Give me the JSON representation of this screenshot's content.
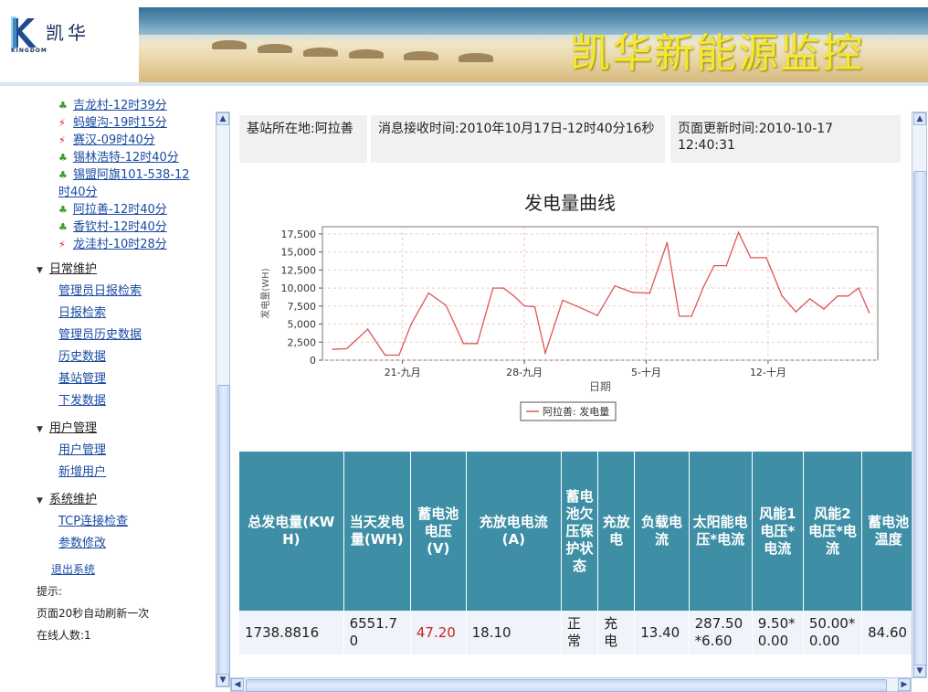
{
  "header": {
    "logo_text": "凯华",
    "logo_sub": "KINGDOM",
    "title": "凯华新能源监控"
  },
  "sidebar": {
    "stations": [
      {
        "label": "吉龙村-12时39分",
        "status": "ok"
      },
      {
        "label": "蚂蝗沟-19时15分",
        "status": "bad"
      },
      {
        "label": "赛汉-09时40分",
        "status": "bad"
      },
      {
        "label": "锡林浩特-12时40分",
        "status": "ok"
      },
      {
        "label": "锡盟阿旗101-538-12",
        "label2": "时40分",
        "status": "ok"
      },
      {
        "label": "阿拉善-12时40分",
        "status": "ok"
      },
      {
        "label": "香钦村-12时40分",
        "status": "ok"
      },
      {
        "label": "龙洼村-10时28分",
        "status": "bad"
      }
    ],
    "groups": [
      {
        "label": "日常维护",
        "items": [
          "管理员日报检索",
          "日报检索",
          "管理员历史数据",
          "历史数据",
          "基站管理",
          "下发数据"
        ]
      },
      {
        "label": "用户管理",
        "items": [
          "用户管理",
          "新增用户"
        ]
      },
      {
        "label": "系统维护",
        "items": [
          "TCP连接检查",
          "参数修改"
        ]
      }
    ],
    "logout": "退出系统",
    "tip_label": "提示:",
    "refresh_note": "页面20秒自动刷新一次",
    "online": "在线人数:1"
  },
  "info": {
    "location": "基站所在地:阿拉善",
    "received": "消息接收时间:2010年10月17日-12时40分16秒",
    "updated": "页面更新时间:2010-10-17 12:40:31"
  },
  "chart_data": {
    "type": "line",
    "title": "发电量曲线",
    "xlabel": "日期",
    "ylabel": "发电量(WH)",
    "ylim": [
      0,
      18500
    ],
    "yticks": [
      "0",
      "2,500",
      "5,000",
      "7,500",
      "10,000",
      "12,500",
      "15,000",
      "17,500"
    ],
    "xticks": [
      {
        "label": "21-九月",
        "day": 21
      },
      {
        "label": "28-九月",
        "day": 28
      },
      {
        "label": "5-十月",
        "day": 35
      },
      {
        "label": "12-十月",
        "day": 42
      }
    ],
    "series": [
      {
        "name": "阿拉善: 发电量",
        "color": "#e05555",
        "x": [
          17,
          17.8,
          19,
          20,
          20.8,
          21.5,
          22.5,
          23.5,
          24.5,
          25.3,
          26.2,
          26.8,
          27.4,
          28,
          28.6,
          29.2,
          30.2,
          31,
          32.2,
          33.2,
          34.2,
          35.2,
          36.2,
          36.9,
          37.6,
          38.3,
          38.9,
          39.6,
          40.3,
          41,
          41.9,
          42.8,
          43.6,
          44.4,
          45.2,
          46,
          46.6,
          47.2,
          47.8
        ],
        "values": [
          1500,
          1600,
          4300,
          700,
          700,
          5000,
          9300,
          7600,
          2300,
          2300,
          10000,
          10000,
          8900,
          7500,
          7400,
          1000,
          8300,
          7500,
          6200,
          10300,
          9400,
          9300,
          16300,
          6100,
          6100,
          10200,
          13100,
          13100,
          17700,
          14200,
          14200,
          8900,
          6700,
          8500,
          7100,
          8900,
          8900,
          10000,
          6600
        ]
      }
    ]
  },
  "table": {
    "headers": [
      "总发电量(KWH)",
      "当天发电量(WH)",
      "蓄电池电压(V)",
      "充放电电流(A)",
      "蓄电池欠压保护状态",
      "充放电",
      "负载电流",
      "太阳能电压*电流",
      "风能1电压*电流",
      "风能2电压*电流",
      "蓄电池温度"
    ],
    "rows": [
      [
        "1738.8816",
        "6551.70",
        "47.20",
        "18.10",
        "正常",
        "充电",
        "13.40",
        "287.50*6.60",
        "9.50*0.00",
        "50.00*0.00",
        "84.60"
      ]
    ]
  }
}
